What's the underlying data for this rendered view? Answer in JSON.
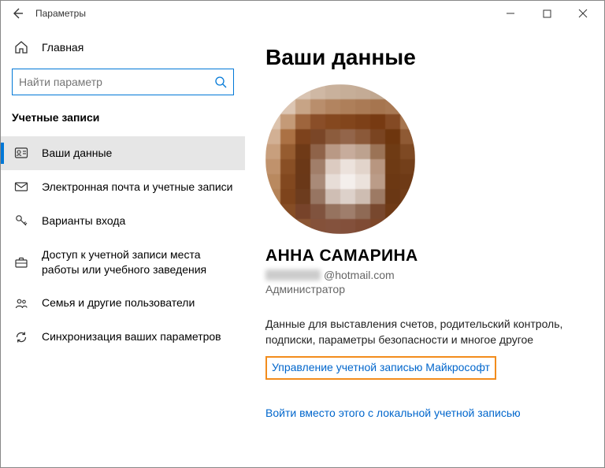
{
  "window": {
    "title": "Параметры"
  },
  "sidebar": {
    "home": "Главная",
    "search_placeholder": "Найти параметр",
    "category": "Учетные записи",
    "items": [
      {
        "label": "Ваши данные"
      },
      {
        "label": "Электронная почта и учетные записи"
      },
      {
        "label": "Варианты входа"
      },
      {
        "label": "Доступ к учетной записи места работы или учебного заведения"
      },
      {
        "label": "Семья и другие пользователи"
      },
      {
        "label": "Синхронизация ваших параметров"
      }
    ]
  },
  "content": {
    "heading": "Ваши данные",
    "user_name": "АННА САМАРИНА",
    "email_domain": "@hotmail.com",
    "role": "Администратор",
    "description": "Данные для выставления счетов, родительский контроль, подписки, параметры безопасности и многое другое",
    "manage_link": "Управление учетной записью Майкрософт",
    "local_login_link": "Войти вместо этого с локальной учетной записью"
  },
  "avatar_colors": [
    "eadfd6",
    "e7d8cc",
    "d9c4b2",
    "cfb8a4",
    "c9b19c",
    "c6ae98",
    "c4ab95",
    "c0a790",
    "bfa68f",
    "c1a992",
    "e4d4c6",
    "dcc5b2",
    "c7a486",
    "b98e6c",
    "b28460",
    "ae7f5a",
    "aa7a55",
    "a6754f",
    "a97954",
    "b5896a",
    "dcc3ad",
    "c49a77",
    "9e653d",
    "8a4e28",
    "85481f",
    "82451c",
    "7d4018",
    "773a12",
    "844a24",
    "a67650",
    "d2b094",
    "ab7144",
    "7d421c",
    "7a4627",
    "8c5c3d",
    "93654a",
    "8b5939",
    "7a4421",
    "6e360e",
    "8f5a34",
    "c89f7d",
    "965c30",
    "6f3a17",
    "8f6349",
    "b99985",
    "c7ac9c",
    "bda28f",
    "9b7356",
    "6f3b14",
    "7e4923",
    "c0926c",
    "894f25",
    "6b3817",
    "a17e69",
    "dccbc1",
    "ece2dc",
    "e2d4cb",
    "b89680",
    "6e3a14",
    "733f1a",
    "b9895f",
    "82481f",
    "6a3818",
    "a98a78",
    "e7ddd7",
    "f4efec",
    "ebe2dc",
    "bb9c88",
    "6c3813",
    "6e3a16",
    "b48257",
    "7e441c",
    "6d3c1e",
    "977562",
    "cfbeb4",
    "ddd1ca",
    "cebdb2",
    "9d7a64",
    "6a3714",
    "713d19",
    "b4835a",
    "864d25",
    "77432a",
    "80533e",
    "96735f",
    "9f7e6c",
    "8f6a55",
    "78482e",
    "6f3a16",
    "7c4723",
    "bf9470",
    "9d693f",
    "8b5634",
    "84513a",
    "84523d",
    "83503b",
    "7f4b34",
    "7d4729",
    "854f2b",
    "95643e"
  ]
}
